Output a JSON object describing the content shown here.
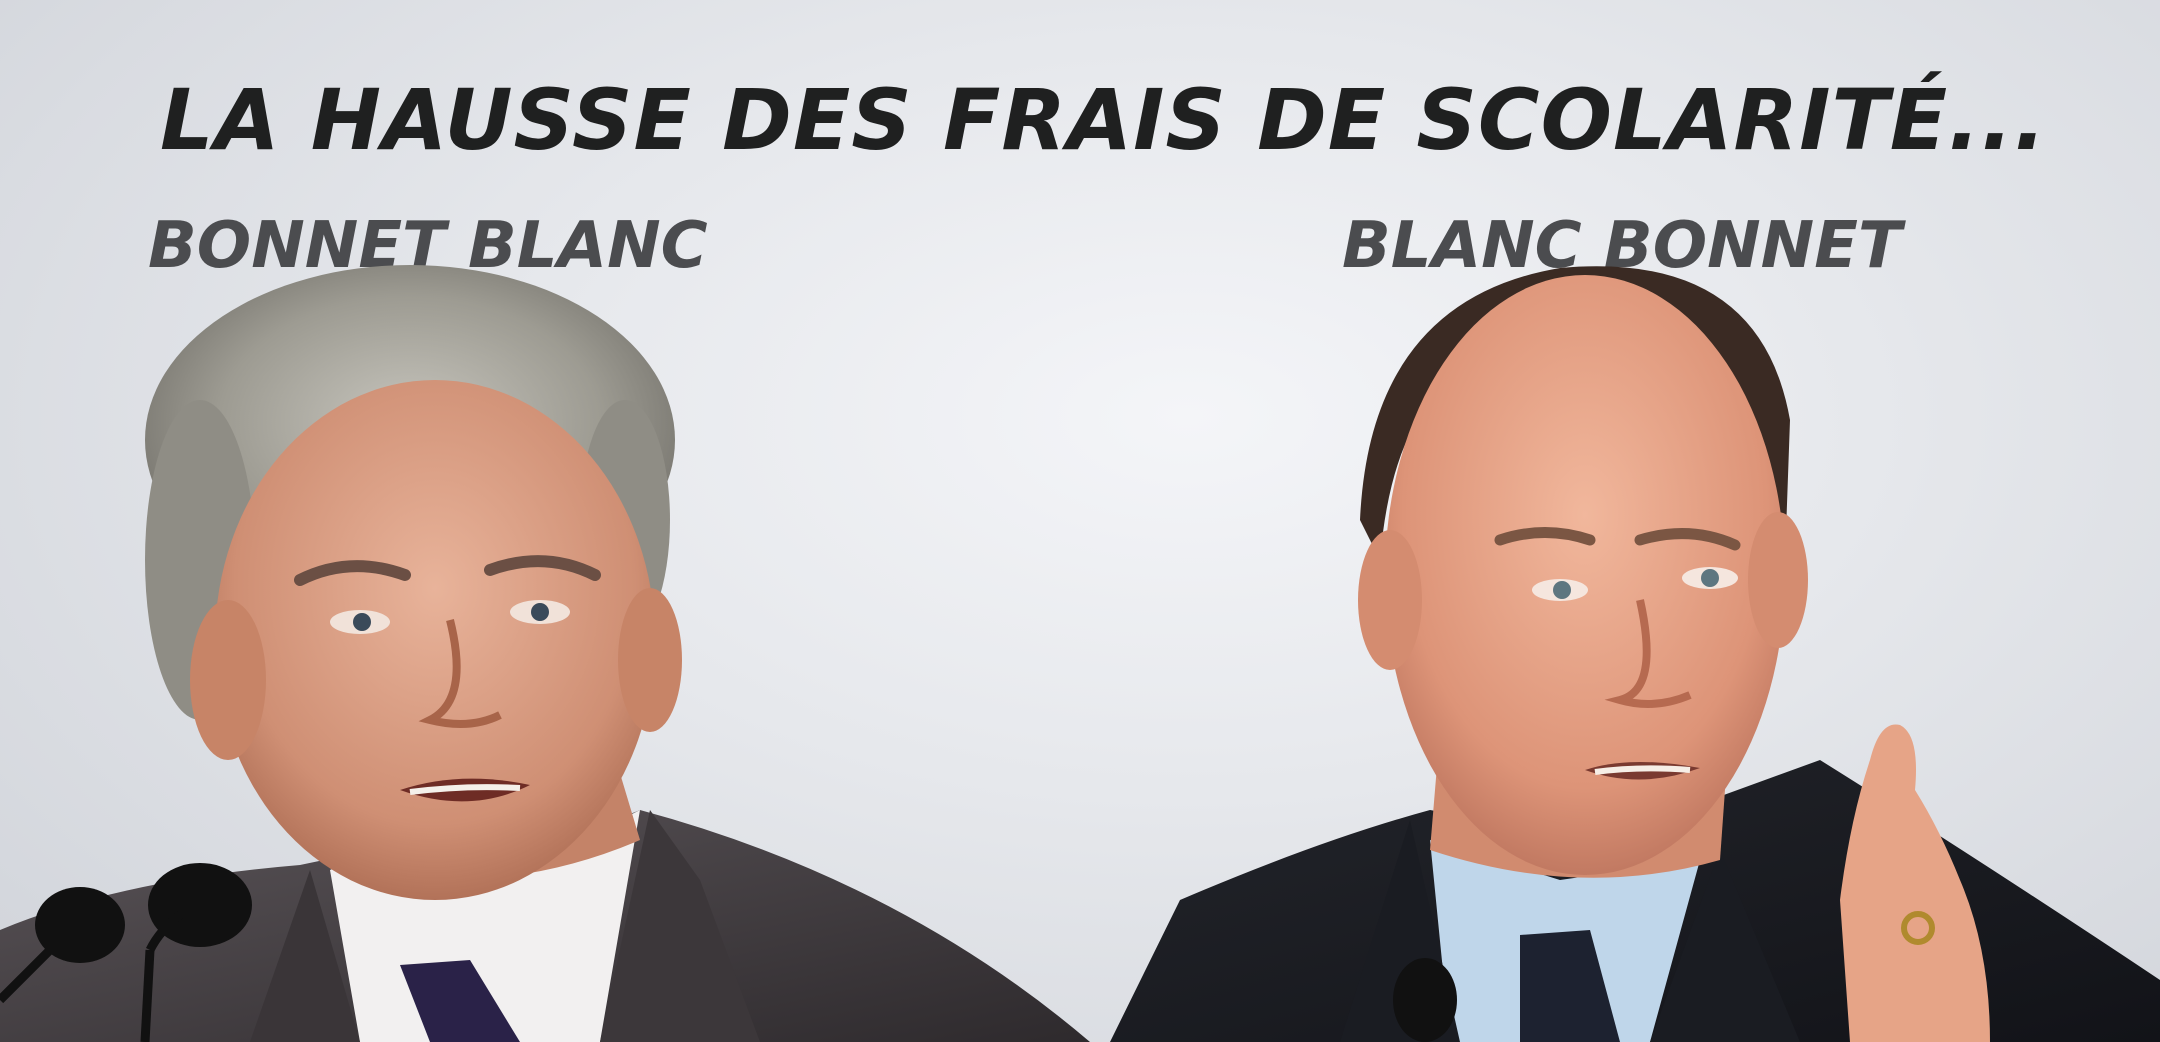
{
  "headline": "LA HAUSSE DES FRAIS DE SCOLARITÉ...",
  "left_label": "BONNET BLANC",
  "right_label": "BLANC BONNET",
  "colors": {
    "headline": "#1f2020",
    "labels": "#4b4c4f",
    "background": "#e6e8ec"
  }
}
